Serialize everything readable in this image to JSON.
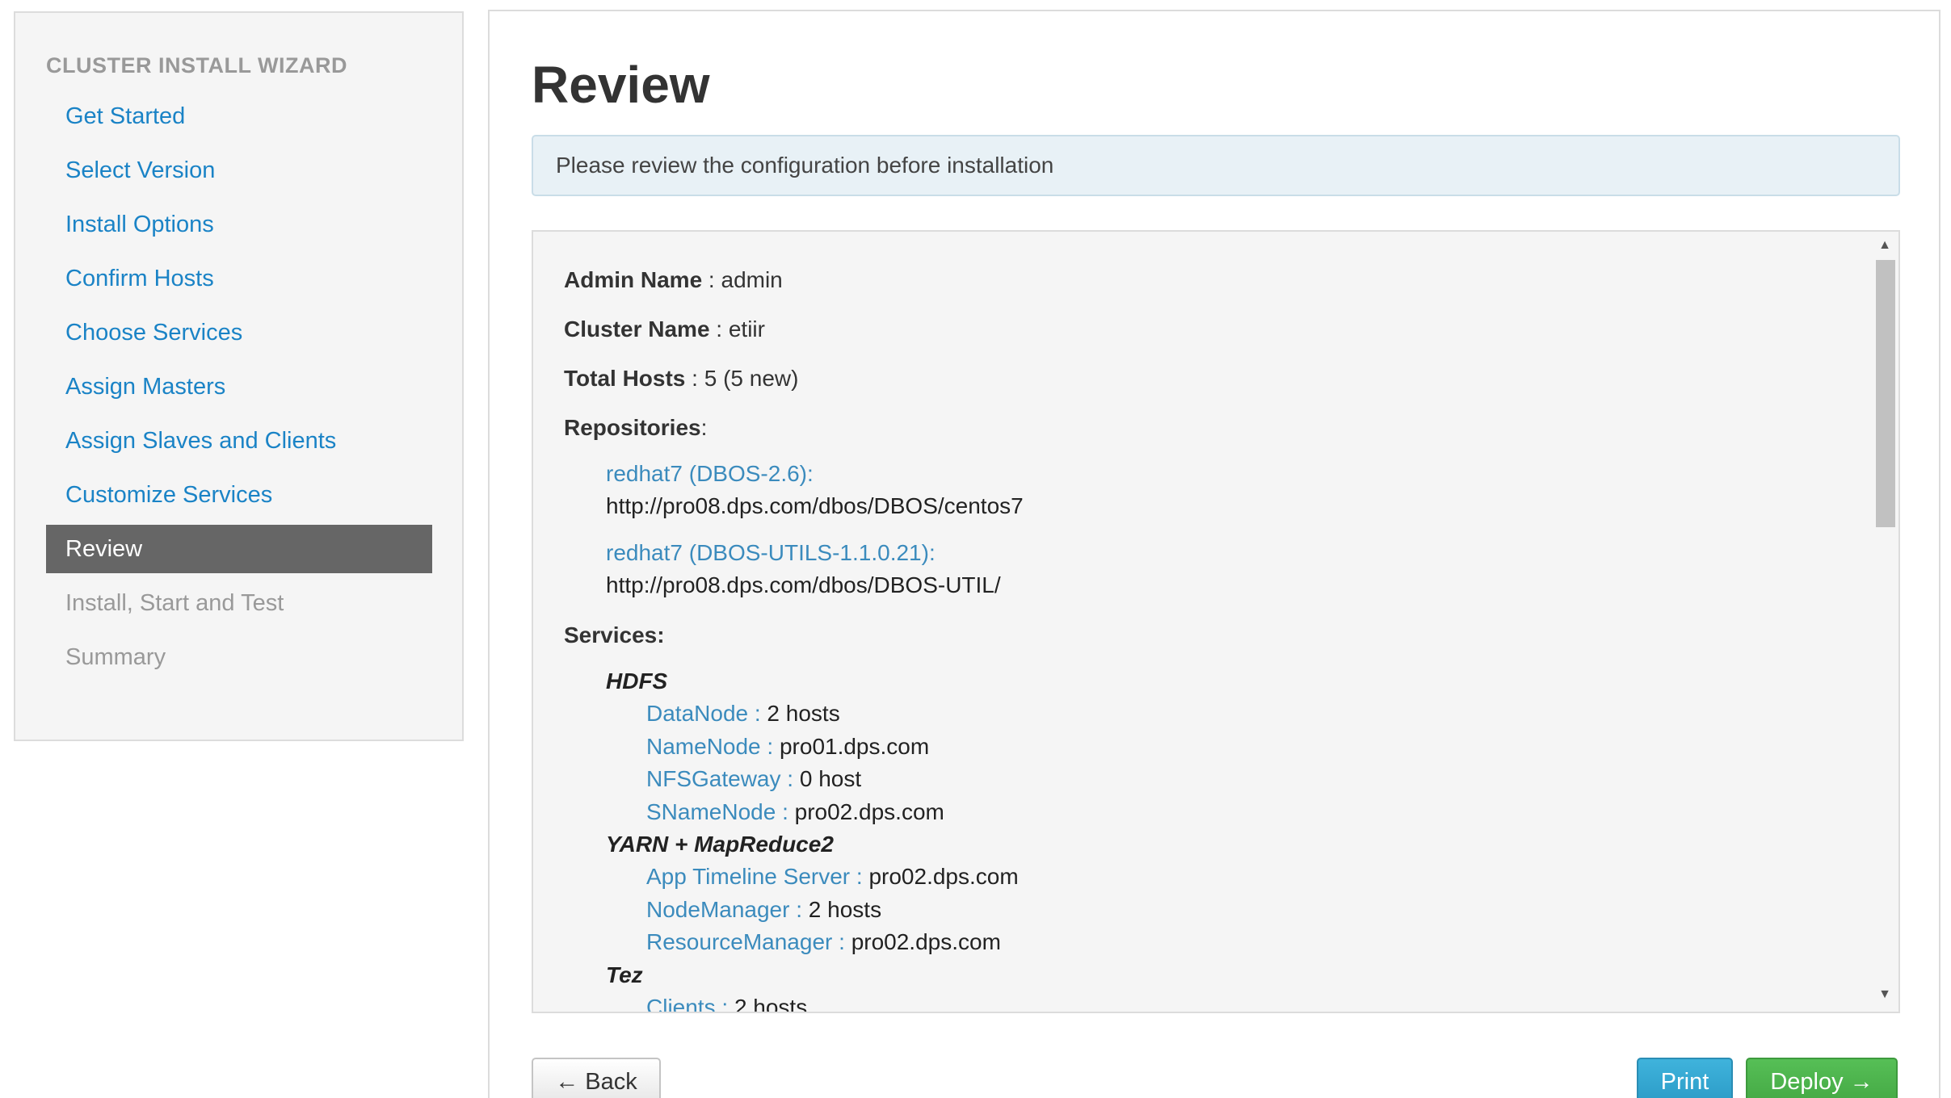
{
  "sidebar": {
    "header": "CLUSTER INSTALL WIZARD",
    "items": [
      {
        "label": "Get Started"
      },
      {
        "label": "Select Version"
      },
      {
        "label": "Install Options"
      },
      {
        "label": "Confirm Hosts"
      },
      {
        "label": "Choose Services"
      },
      {
        "label": "Assign Masters"
      },
      {
        "label": "Assign Slaves and Clients"
      },
      {
        "label": "Customize Services"
      },
      {
        "label": "Review"
      },
      {
        "label": "Install, Start and Test"
      },
      {
        "label": "Summary"
      }
    ]
  },
  "main": {
    "title": "Review",
    "alert": "Please review the configuration before installation",
    "review": {
      "admin_label": "Admin Name",
      "admin_value": " : admin",
      "cluster_label": "Cluster Name",
      "cluster_value": " : etiir",
      "hosts_label": "Total Hosts",
      "hosts_value": " : 5 (5 new)",
      "repos_label": "Repositories",
      "repos_suffix": ":",
      "repositories": [
        {
          "name": "redhat7 (DBOS-2.6):",
          "url": "http://pro08.dps.com/dbos/DBOS/centos7"
        },
        {
          "name": "redhat7 (DBOS-UTILS-1.1.0.21):",
          "url": "http://pro08.dps.com/dbos/DBOS-UTIL/"
        }
      ],
      "services_label": "Services:",
      "services": [
        {
          "name": "HDFS",
          "components": [
            {
              "name": "DataNode : ",
              "value": "2 hosts"
            },
            {
              "name": "NameNode : ",
              "value": "pro01.dps.com"
            },
            {
              "name": "NFSGateway : ",
              "value": "0 host"
            },
            {
              "name": "SNameNode : ",
              "value": "pro02.dps.com"
            }
          ]
        },
        {
          "name": "YARN + MapReduce2",
          "components": [
            {
              "name": "App Timeline Server : ",
              "value": "pro02.dps.com"
            },
            {
              "name": "NodeManager : ",
              "value": "2 hosts"
            },
            {
              "name": "ResourceManager : ",
              "value": "pro02.dps.com"
            }
          ]
        },
        {
          "name": "Tez",
          "components": [
            {
              "name": "Clients : ",
              "value": "2 hosts"
            }
          ]
        }
      ]
    },
    "scroll_up": "▲",
    "scroll_down": "▼"
  },
  "footer": {
    "back_label": "← Back",
    "print_label": "Print",
    "deploy_label": "Deploy →"
  },
  "colors": {
    "link": "#1a83c6",
    "active_bg": "#666666",
    "print": "#2b9bc6",
    "deploy": "#44a844"
  }
}
